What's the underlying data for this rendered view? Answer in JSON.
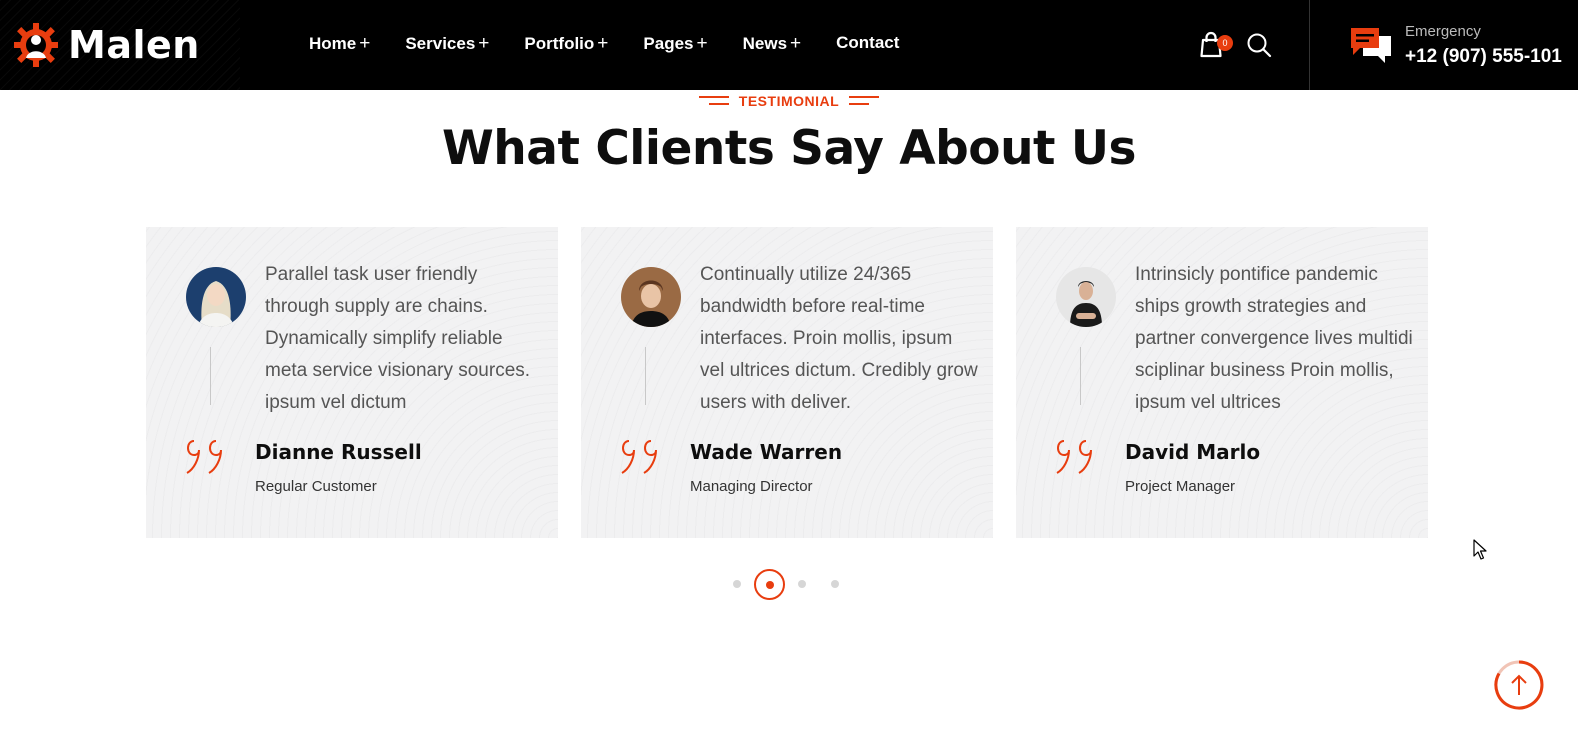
{
  "brand": {
    "name": "Malen",
    "accent_color": "#e83d0f",
    "logo_icon": "gear-worker-icon"
  },
  "nav": {
    "items": [
      {
        "label": "Home",
        "suffix": "+"
      },
      {
        "label": "Services",
        "suffix": "+"
      },
      {
        "label": "Portfolio",
        "suffix": "+"
      },
      {
        "label": "Pages",
        "suffix": "+"
      },
      {
        "label": "News",
        "suffix": "+"
      },
      {
        "label": "Contact",
        "suffix": ""
      }
    ]
  },
  "cart": {
    "count": "0",
    "icon": "shopping-bag-icon"
  },
  "search": {
    "icon": "search-icon"
  },
  "emergency": {
    "label": "Emergency",
    "phone": "+12 (907) 555-101",
    "icon": "chat-bubbles-icon"
  },
  "section": {
    "sub_label": "TESTIMONIAL",
    "title": "What Clients Say About Us"
  },
  "testimonials": [
    {
      "text": "Parallel task user friendly through supply are chains. Dynamically simplify reliable meta service visionary sources. ipsum vel dictum",
      "name": "Dianne Russell",
      "role": "Regular Customer"
    },
    {
      "text": "Continually utilize 24/365 bandwidth before real-time interfaces. Proin mollis, ipsum vel ultrices dictum. Credibly grow users with deliver.",
      "name": "Wade Warren",
      "role": "Managing Director"
    },
    {
      "text": "Intrinsicly pontifice pandemic ships growth strategies and partner convergence lives multidi sciplinar business Proin mollis, ipsum vel ultrices",
      "name": "David Marlo",
      "role": "Project Manager"
    }
  ],
  "pagination": {
    "total": 4,
    "active": 2
  }
}
